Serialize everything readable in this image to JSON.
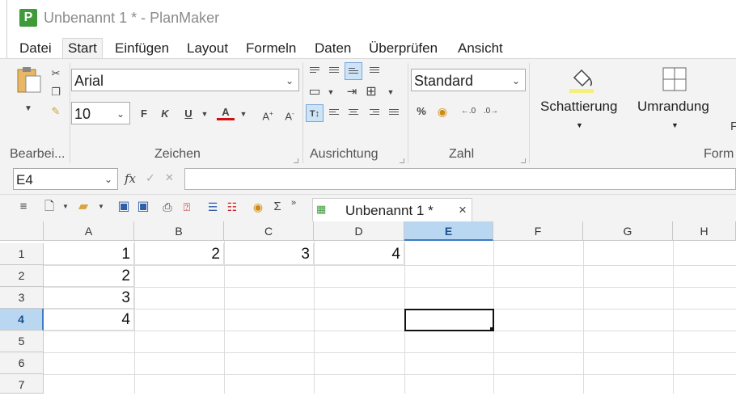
{
  "window": {
    "app_icon_letter": "P",
    "title": "Unbenannt 1 * - PlanMaker"
  },
  "menu": {
    "items": [
      "Datei",
      "Start",
      "Einfügen",
      "Layout",
      "Formeln",
      "Daten",
      "Überprüfen",
      "Ansicht"
    ],
    "active": "Start"
  },
  "ribbon": {
    "groups": {
      "clipboard": "Bearbei...",
      "font": "Zeichen",
      "alignment": "Ausrichtung",
      "number": "Zahl",
      "format": "Form"
    },
    "font_name": "Arial",
    "font_size": "10",
    "number_format": "Standard",
    "shading_label": "Schattierung",
    "border_label": "Umrandung",
    "format_buttons": {
      "bold": "F",
      "italic": "K",
      "underline": "U",
      "color": "A",
      "grow": "A",
      "shrink": "A"
    },
    "number_buttons": {
      "percent": "%"
    }
  },
  "formula_bar": {
    "cell_ref": "E4",
    "fx": "fx",
    "accept": "✓",
    "cancel": "✕",
    "content": ""
  },
  "doc_tab": {
    "title": "Unbenannt 1 *",
    "close": "×"
  },
  "grid": {
    "columns": [
      "A",
      "B",
      "C",
      "D",
      "E",
      "F",
      "G",
      "H"
    ],
    "rows": [
      "1",
      "2",
      "3",
      "4",
      "5",
      "6",
      "7"
    ],
    "selected_cell": "E4",
    "cells": {
      "A1": "1",
      "B1": "2",
      "C1": "3",
      "D1": "4",
      "A2": "2",
      "A3": "3",
      "A4": "4"
    }
  }
}
